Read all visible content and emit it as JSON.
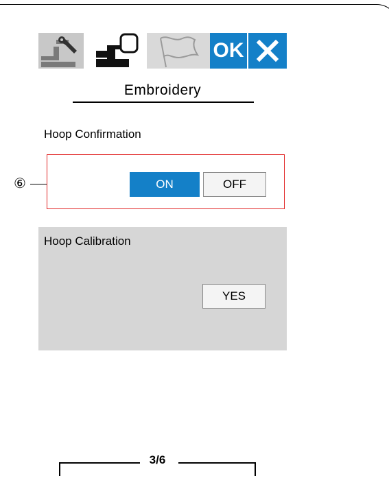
{
  "screen": {
    "tabs": [
      {
        "name": "settings-tools-tab",
        "icon": "wrench-machine-icon"
      },
      {
        "name": "embroidery-settings-tab",
        "icon": "embroidery-machine-icon"
      },
      {
        "name": "language-tab",
        "icon": "flag-icon"
      }
    ],
    "ok_label": "OK",
    "close_icon": "close-icon",
    "title": "Embroidery",
    "hoop_confirmation": {
      "label": "Hoop Confirmation",
      "on_label": "ON",
      "off_label": "OFF",
      "selected": "ON"
    },
    "hoop_calibration": {
      "label": "Hoop Calibration",
      "yes_label": "YES"
    },
    "page_indicator": "3/6"
  },
  "callout": {
    "number": "⑥"
  },
  "colors": {
    "accent": "#1480c8",
    "highlight": "#e02020",
    "band": "#d6d6d6"
  }
}
